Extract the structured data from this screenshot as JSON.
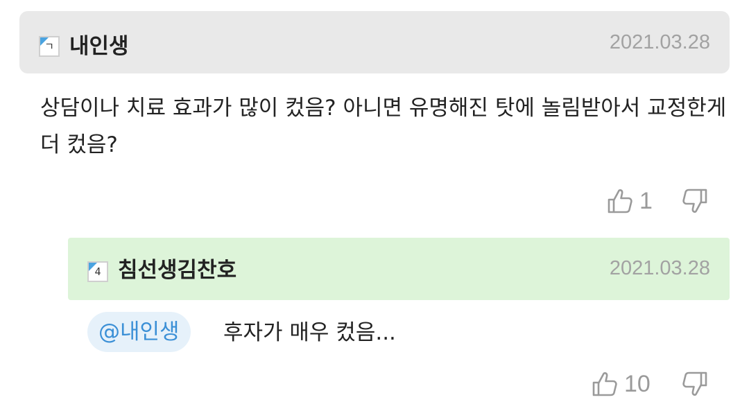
{
  "comment": {
    "level": "ㄱ",
    "username": "내인생",
    "date": "2021.03.28",
    "body": "상담이나 치료 효과가 많이 컸음? 아니면 유명해진 탓에 놀림받아서 교정한게 더 컸음?",
    "likes": "1",
    "accent_color": "#4aa3e0"
  },
  "reply": {
    "level": "4",
    "username": "침선생김찬호",
    "date": "2021.03.28",
    "mention": "@내인생",
    "body": "후자가 매우 컸음...",
    "likes": "10"
  },
  "icons": {
    "like": "thumbs-up-icon",
    "dislike": "thumbs-down-icon"
  }
}
